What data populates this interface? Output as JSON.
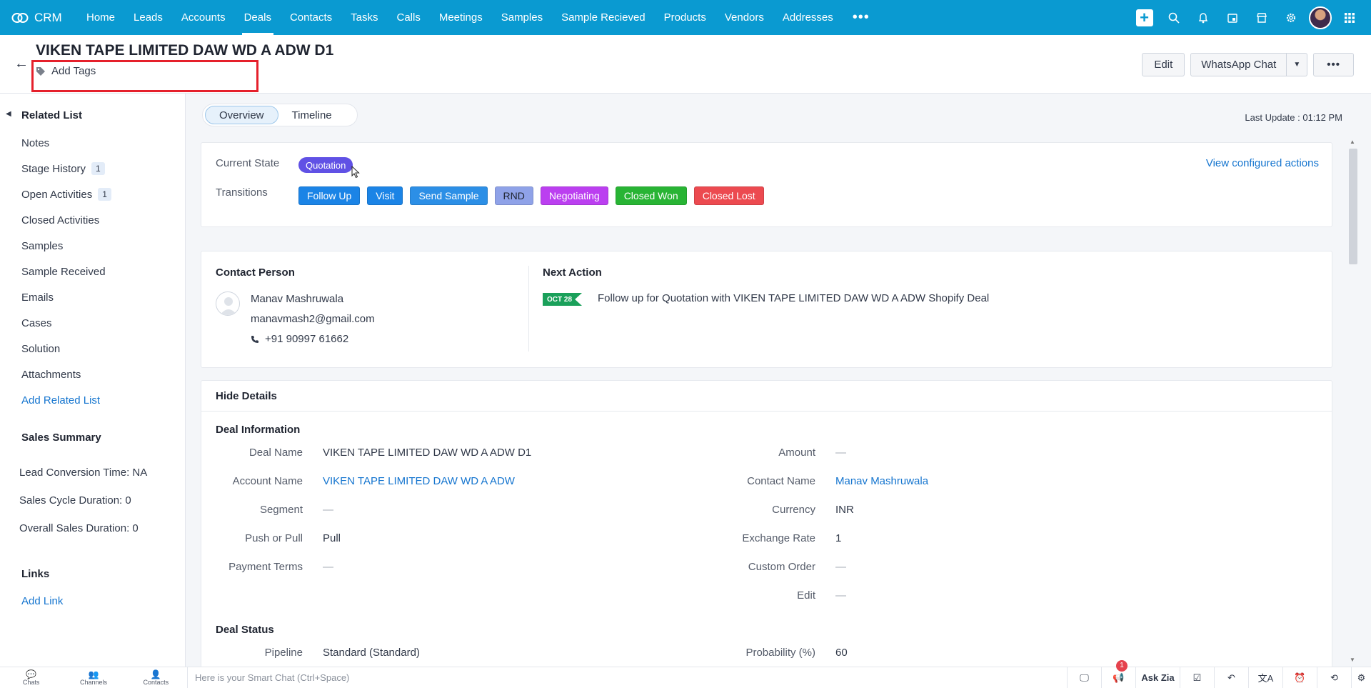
{
  "app": {
    "name": "CRM"
  },
  "nav": {
    "tabs": [
      "Home",
      "Leads",
      "Accounts",
      "Deals",
      "Contacts",
      "Tasks",
      "Calls",
      "Meetings",
      "Samples",
      "Sample Recieved",
      "Products",
      "Vendors",
      "Addresses"
    ],
    "active": "Deals",
    "more": "•••"
  },
  "record": {
    "title": "VIKEN TAPE LIMITED DAW WD A ADW D1",
    "add_tags": "Add Tags",
    "buttons": {
      "edit": "Edit",
      "whatsapp": "WhatsApp Chat",
      "more": "•••"
    }
  },
  "sidebar": {
    "related_list_title": "Related List",
    "items": [
      {
        "label": "Notes"
      },
      {
        "label": "Stage History",
        "count": "1"
      },
      {
        "label": "Open Activities",
        "count": "1"
      },
      {
        "label": "Closed Activities"
      },
      {
        "label": "Samples"
      },
      {
        "label": "Sample Received"
      },
      {
        "label": "Emails"
      },
      {
        "label": "Cases"
      },
      {
        "label": "Solution"
      },
      {
        "label": "Attachments"
      }
    ],
    "add_related_list": "Add Related List",
    "sales_summary_title": "Sales Summary",
    "stats": [
      "Lead Conversion Time: NA",
      "Sales Cycle Duration: 0",
      "Overall Sales Duration: 0"
    ],
    "links_title": "Links",
    "add_link": "Add Link"
  },
  "tabs": {
    "overview": "Overview",
    "timeline": "Timeline"
  },
  "last_update": "Last Update : 01:12 PM",
  "blueprint": {
    "current_state_label": "Current State",
    "current_state": "Quotation",
    "transitions_label": "Transitions",
    "view_actions": "View configured actions",
    "transitions": [
      {
        "label": "Follow Up",
        "color": "#1b84e6"
      },
      {
        "label": "Visit",
        "color": "#1b84e6"
      },
      {
        "label": "Send Sample",
        "color": "#2c8fe6"
      },
      {
        "label": "RND",
        "color": "#8fa2e8"
      },
      {
        "label": "Negotiating",
        "color": "#bb3ff0"
      },
      {
        "label": "Closed Won",
        "color": "#28b434"
      },
      {
        "label": "Closed Lost",
        "color": "#ec4a50"
      }
    ]
  },
  "contact": {
    "title": "Contact Person",
    "name": "Manav Mashruwala",
    "email": "manavmash2@gmail.com",
    "phone": "+91 90997 61662"
  },
  "next_action": {
    "title": "Next Action",
    "date": "OCT 28",
    "text": "Follow up for Quotation with VIKEN TAPE LIMITED DAW WD A ADW Shopify Deal"
  },
  "details": {
    "hide_details": "Hide Details",
    "deal_info_title": "Deal Information",
    "left": [
      {
        "label": "Deal Name",
        "value": "VIKEN TAPE LIMITED DAW WD A ADW D1"
      },
      {
        "label": "Account Name",
        "value": "VIKEN TAPE LIMITED DAW WD A ADW"
      },
      {
        "label": "Segment",
        "value": "—"
      },
      {
        "label": "Push or Pull",
        "value": "Pull"
      },
      {
        "label": "Payment Terms",
        "value": "—"
      }
    ],
    "right": [
      {
        "label": "Amount",
        "value": "—"
      },
      {
        "label": "Contact Name",
        "value": "Manav Mashruwala"
      },
      {
        "label": "Currency",
        "value": "INR"
      },
      {
        "label": "Exchange Rate",
        "value": "1"
      },
      {
        "label": "Custom Order",
        "value": "—"
      },
      {
        "label": "Edit",
        "value": "—"
      }
    ],
    "deal_status_title": "Deal Status",
    "status_left": {
      "label": "Pipeline",
      "value": "Standard (Standard)"
    },
    "status_right": {
      "label": "Probability (%)",
      "value": "60"
    }
  },
  "bottom": {
    "chats": "Chats",
    "channels": "Channels",
    "contacts": "Contacts",
    "smartchat": "Here is your Smart Chat (Ctrl+Space)",
    "ask_zia": "Ask Zia",
    "notif_count": "1"
  }
}
